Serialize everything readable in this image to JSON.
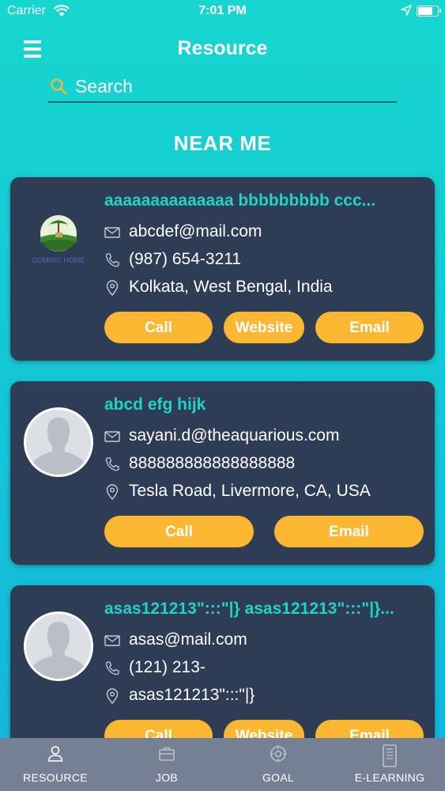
{
  "status_bar": {
    "carrier": "Carrier",
    "time": "7:01 PM"
  },
  "header": {
    "title": "Resource"
  },
  "search": {
    "placeholder": "Search"
  },
  "section_title": "NEAR ME",
  "colors": {
    "accent_teal": "#1fd4c6",
    "button_yellow": "#fbb731",
    "card_bg": "#2f3c55",
    "tabbar_bg": "#768095"
  },
  "resources": [
    {
      "name": "aaaaaaaaaaaaaa bbbbbbbbb ccc...",
      "image": "coming-home-logo",
      "logo_caption": "COMING HOME",
      "email": "abcdef@mail.com",
      "phone": "(987) 654-3211",
      "address": "Kolkata, West Bengal, India",
      "buttons": [
        "Call",
        "Website",
        "Email"
      ]
    },
    {
      "name": "abcd efg hijk",
      "image": "avatar-placeholder",
      "email": "sayani.d@theaquarious.com",
      "phone": "888888888888888888",
      "address": "Tesla Road, Livermore, CA, USA",
      "buttons": [
        "Call",
        "Email"
      ]
    },
    {
      "name": "asas121213\":::\"|} asas121213\":::\"|}...",
      "image": "avatar-placeholder",
      "email": "asas@mail.com",
      "phone": "(121) 213-",
      "address": "asas121213\":::\"|}",
      "buttons": [
        "Call",
        "Website",
        "Email"
      ]
    }
  ],
  "tabbar": {
    "tabs": [
      {
        "label": "RESOURCE",
        "icon": "person-icon"
      },
      {
        "label": "JOB",
        "icon": "briefcase-icon"
      },
      {
        "label": "GOAL",
        "icon": "target-icon"
      },
      {
        "label": "E-LEARNING",
        "icon": "book-icon"
      }
    ]
  }
}
